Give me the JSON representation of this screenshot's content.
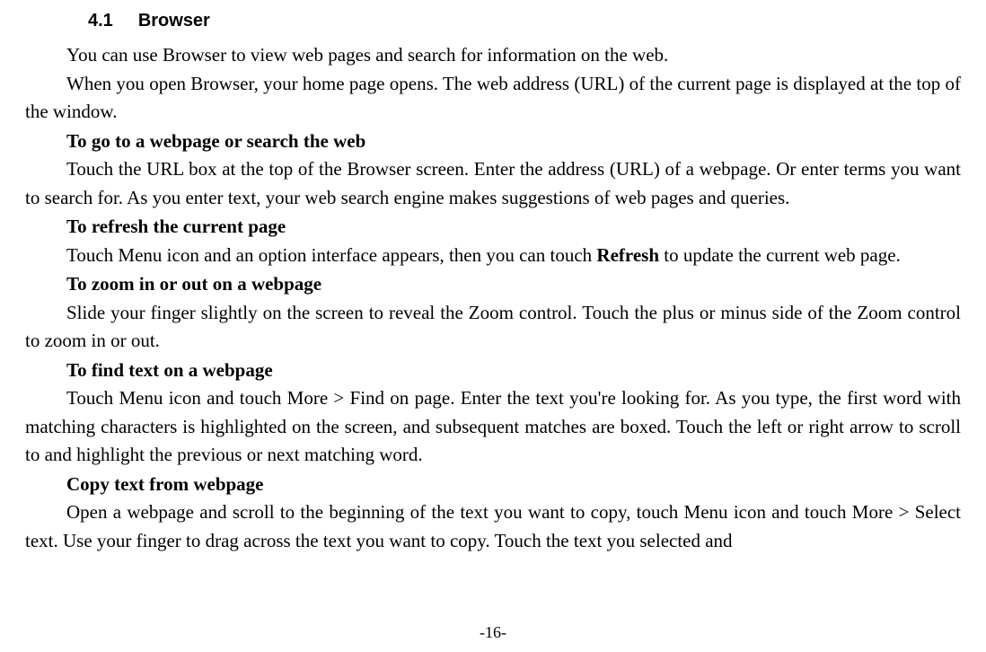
{
  "section": {
    "number": "4.1",
    "title": "Browser"
  },
  "paragraphs": {
    "p1": "You can use Browser to view web pages and search for information on the web.",
    "p2": "When you open Browser, your home page opens. The web address (URL) of the current page is displayed at the top of the window.",
    "h1": "To go to a webpage or search the web",
    "p3": "Touch the URL box at the top of the Browser screen. Enter the address (URL) of a webpage. Or enter terms you want to search for. As you enter text, your web search engine makes suggestions of web pages and queries.",
    "h2": "To refresh the current page",
    "p4a": "Touch Menu icon and an option interface appears, then you can touch ",
    "p4b": "Refresh",
    "p4c": " to update the current web page.",
    "h3": "To zoom in or out on a webpage",
    "p5": "Slide your finger slightly on the screen to reveal the Zoom control. Touch the plus or minus side of the Zoom control to zoom in or out.",
    "h4": "To find text on a webpage",
    "p6": "Touch Menu icon and touch More > Find on page. Enter the text you're looking for. As you type, the first word with matching characters is highlighted on the screen, and subsequent matches are boxed. Touch the left or right arrow to scroll to and highlight the previous or next matching word.",
    "h5": "Copy text from webpage",
    "p7": "Open a webpage and scroll to the beginning of the text you want to copy, touch Menu icon and touch More > Select text. Use your finger to drag across the text you want to copy. Touch the text you selected and"
  },
  "pageNumber": "-16-"
}
